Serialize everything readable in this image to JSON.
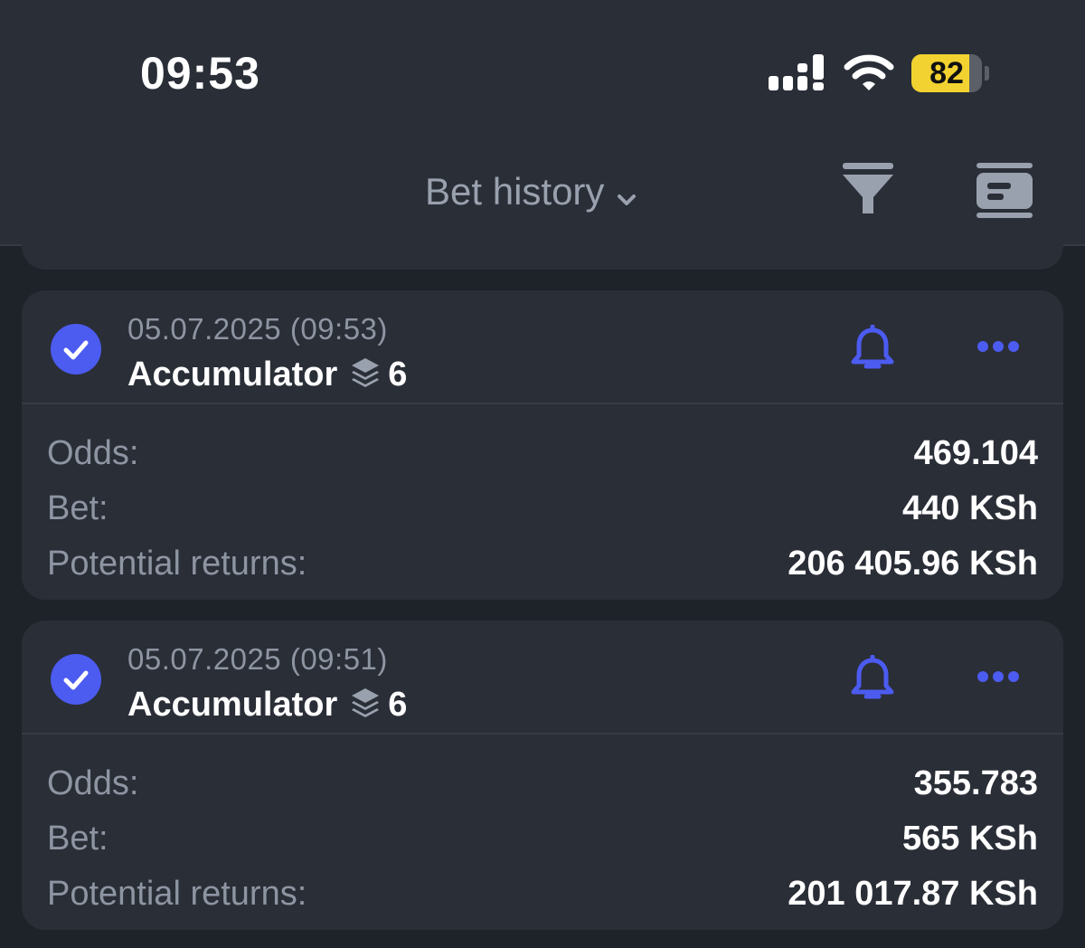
{
  "status_bar": {
    "time": "09:53",
    "battery_level": "82",
    "battery_fraction": 0.82
  },
  "nav": {
    "title": "Bet history",
    "icons": [
      "chevron-down-icon",
      "filter-icon",
      "coupon-icon"
    ]
  },
  "colors": {
    "background": "#1e2229",
    "card": "#2a2e37",
    "accent": "#4c5bf0",
    "label": "#8e95a2",
    "battery": "#f2d230"
  },
  "labels": {
    "odds": "Odds:",
    "bet": "Bet:",
    "potential_returns": "Potential returns:"
  },
  "bets": [
    {
      "date": "05.07.2025 (09:53)",
      "type": "Accumulator",
      "count": "6",
      "odds": "469.104",
      "bet": "440 KSh",
      "potential_returns": "206 405.96 KSh"
    },
    {
      "date": "05.07.2025 (09:51)",
      "type": "Accumulator",
      "count": "6",
      "odds": "355.783",
      "bet": "565 KSh",
      "potential_returns": "201 017.87 KSh"
    }
  ]
}
